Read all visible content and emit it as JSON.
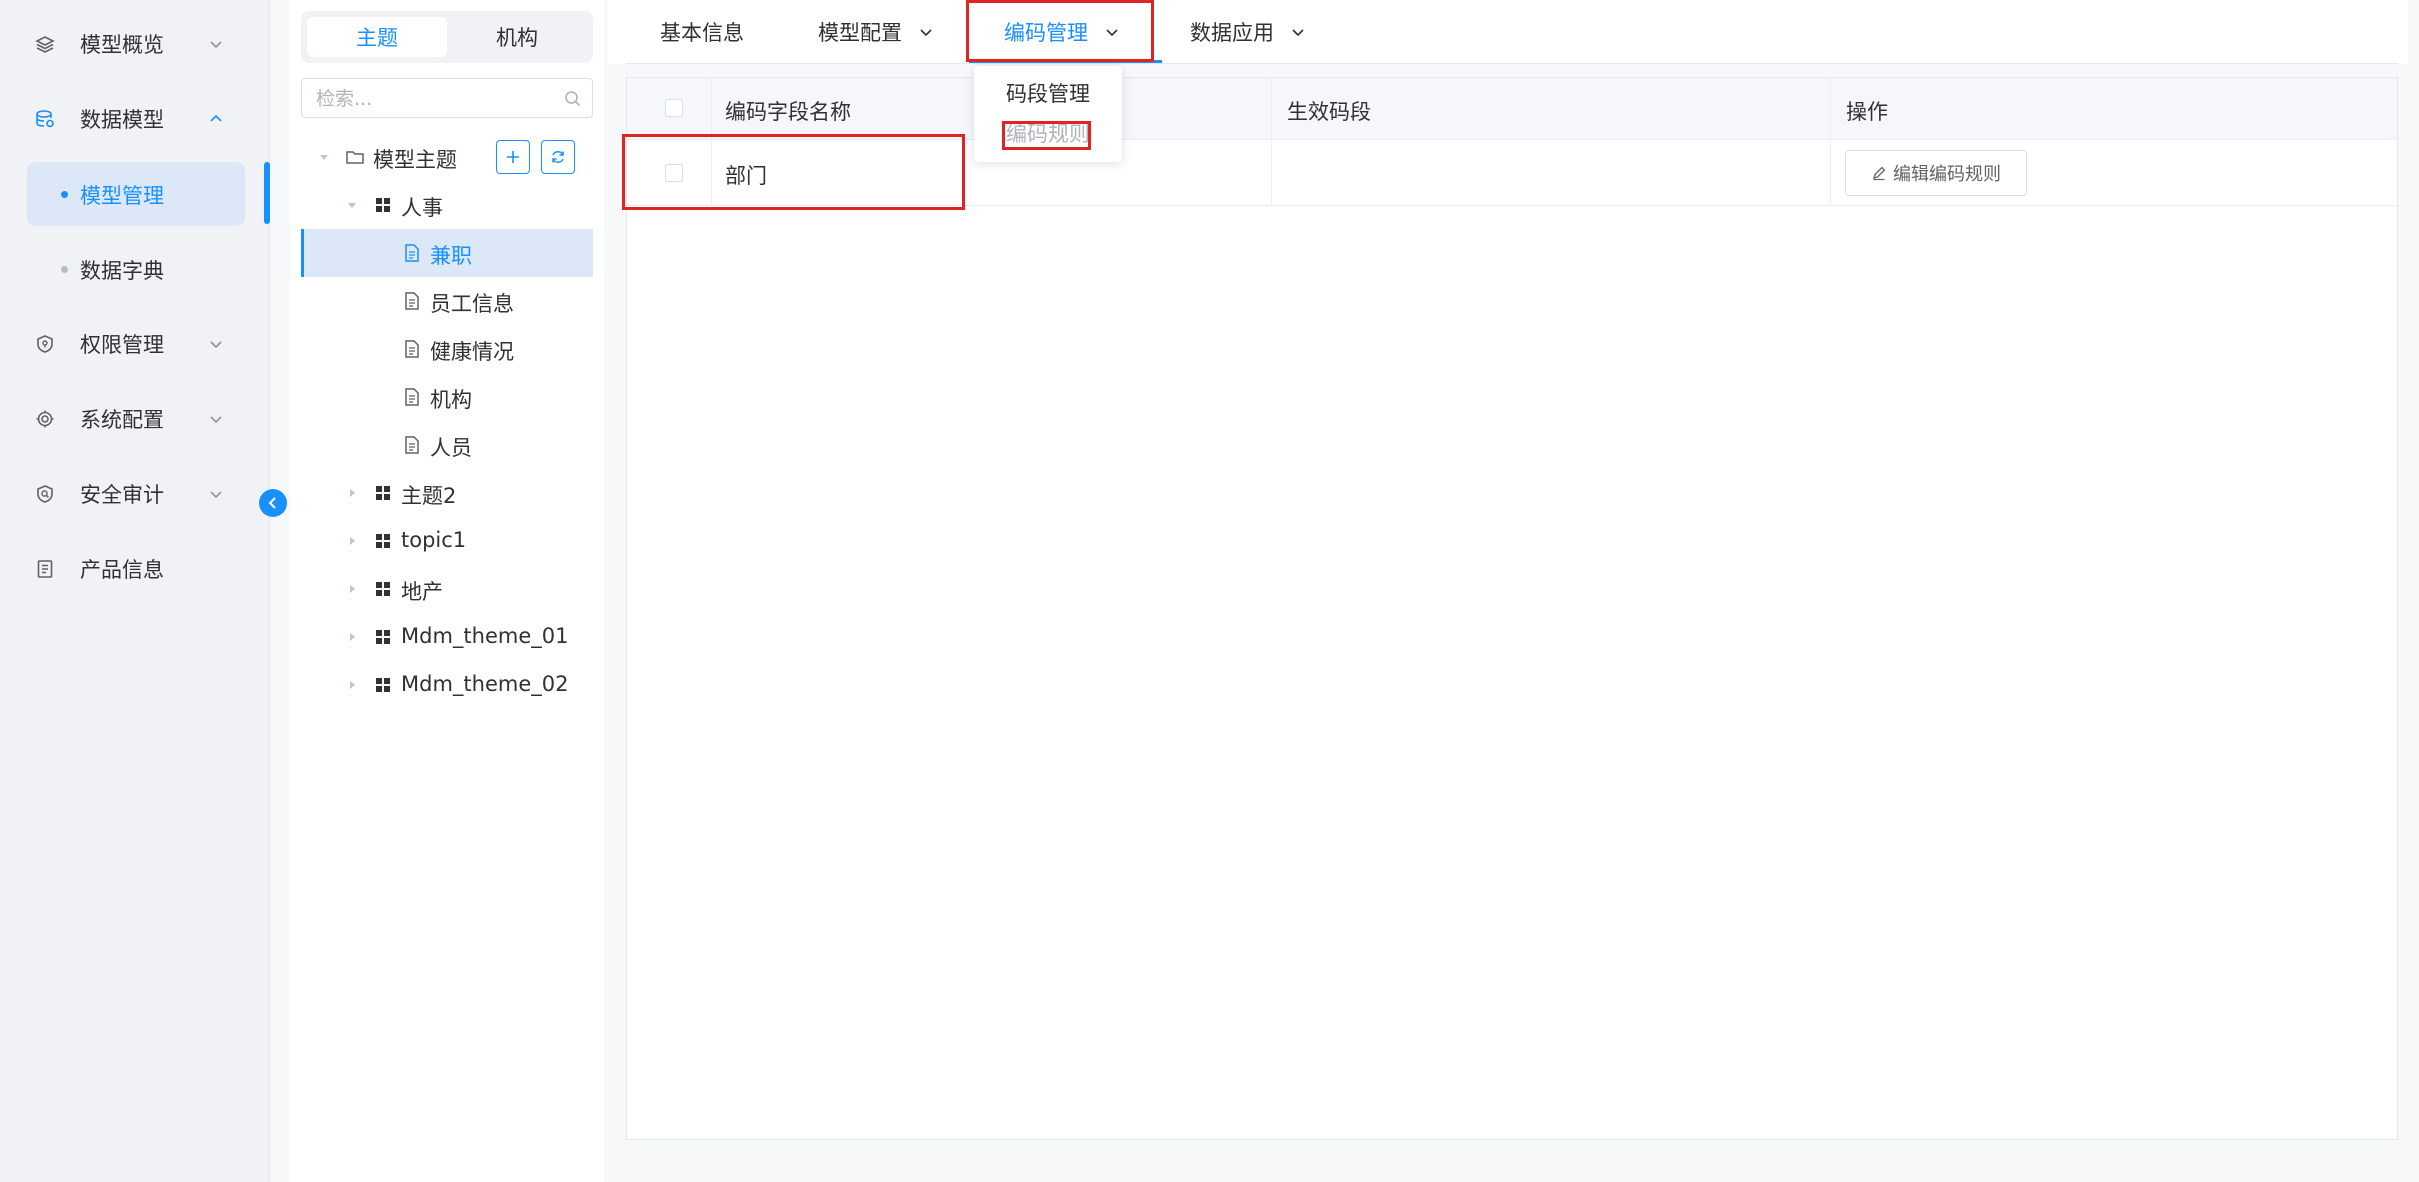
{
  "sidebar": {
    "items": [
      {
        "label": "模型概览",
        "icon": "layers-icon"
      },
      {
        "label": "数据模型",
        "icon": "database-icon"
      },
      {
        "label": "权限管理",
        "icon": "shield-icon"
      },
      {
        "label": "系统配置",
        "icon": "settings-chip-icon"
      },
      {
        "label": "安全审计",
        "icon": "audit-shield-icon"
      },
      {
        "label": "产品信息",
        "icon": "document-icon"
      }
    ],
    "sub_items": [
      {
        "label": "模型管理",
        "active": true
      },
      {
        "label": "数据字典",
        "active": false
      }
    ]
  },
  "tree": {
    "segments": [
      "主题",
      "机构"
    ],
    "search_placeholder": "检索...",
    "root": "模型主题",
    "nodes": [
      "人事",
      "兼职",
      "员工信息",
      "健康情况",
      "机构",
      "人员",
      "主题2",
      "topic1",
      "地产",
      "Mdm_theme_01",
      "Mdm_theme_02"
    ]
  },
  "tabs": [
    "基本信息",
    "模型配置",
    "编码管理",
    "数据应用"
  ],
  "dropdown": [
    "码段管理",
    "编码规则"
  ],
  "table": {
    "headers": [
      "编码字段名称",
      "生效码段",
      "操作"
    ],
    "rows": [
      {
        "name": "部门",
        "segment": "",
        "action": "编辑编码规则"
      }
    ]
  },
  "colors": {
    "accent": "#1890ff",
    "highlight": "#e02424"
  }
}
